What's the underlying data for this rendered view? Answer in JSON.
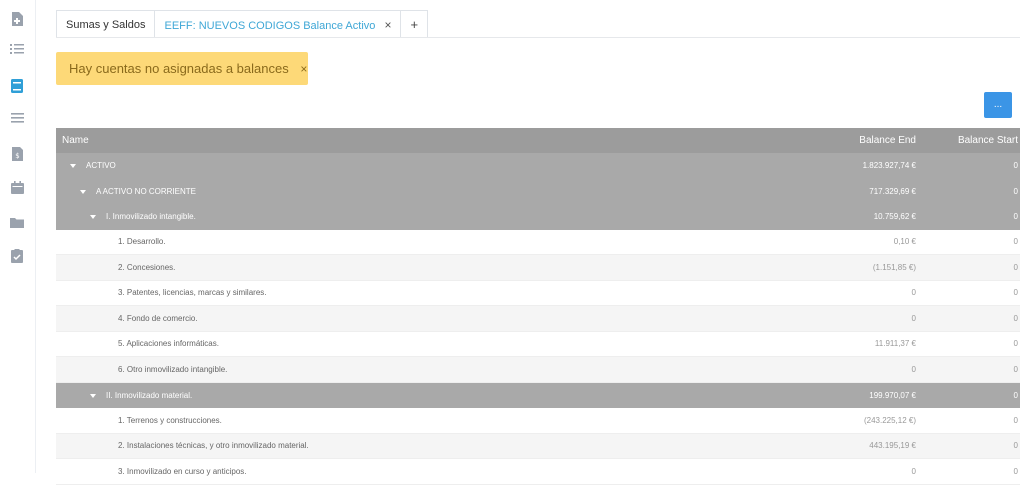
{
  "sidebar": {
    "icons": [
      "file-plus-icon",
      "list-icon",
      "book-icon",
      "menu-icon",
      "invoice-icon",
      "calendar-icon",
      "folder-icon",
      "clipboard-check-icon"
    ],
    "active_icon": "book-icon"
  },
  "tabs": [
    {
      "label": "Sumas y Saldos"
    },
    {
      "label": "EEFF: NUEVOS CODIGOS Balance Activo",
      "close": "×"
    },
    {
      "label": "+"
    }
  ],
  "alert": {
    "text": "Hay cuentas no asignadas a balances",
    "close": "×"
  },
  "more_button": {
    "label": "..."
  },
  "table": {
    "headers": {
      "name": "Name",
      "end": "Balance End",
      "start": "Balance Start"
    },
    "rows": [
      {
        "name": "ACTIVO",
        "end": "1.823.927,74 €",
        "start": "0"
      },
      {
        "name": "A ACTIVO NO CORRIENTE",
        "end": "717.329,69 €",
        "start": "0"
      },
      {
        "name": "I. Inmovilizado intangible.",
        "end": "10.759,62 €",
        "start": "0"
      },
      {
        "name": "1. Desarrollo.",
        "end": "0,10 €",
        "start": "0"
      },
      {
        "name": "2. Concesiones.",
        "end": "(1.151,85 €)",
        "start": "0"
      },
      {
        "name": "3. Patentes, licencias, marcas y similares.",
        "end": "0",
        "start": "0"
      },
      {
        "name": "4. Fondo de comercio.",
        "end": "0",
        "start": "0"
      },
      {
        "name": "5. Aplicaciones informáticas.",
        "end": "11.911,37 €",
        "start": "0"
      },
      {
        "name": "6. Otro inmovilizado intangible.",
        "end": "0",
        "start": "0"
      },
      {
        "name": "II. Inmovilizado material.",
        "end": "199.970,07 €",
        "start": "0"
      },
      {
        "name": "1. Terrenos y construcciones.",
        "end": "(243.225,12 €)",
        "start": "0"
      },
      {
        "name": "2. Instalaciones técnicas, y otro inmovilizado material.",
        "end": "443.195,19 €",
        "start": "0"
      },
      {
        "name": "3. Inmovilizado en curso y anticipos.",
        "end": "0",
        "start": "0"
      }
    ]
  },
  "colors": {
    "accent": "#3b95e6",
    "alert_bg": "#fdd978",
    "tab_active": "#3fa7d6",
    "group_row": "#a9a9a9"
  }
}
